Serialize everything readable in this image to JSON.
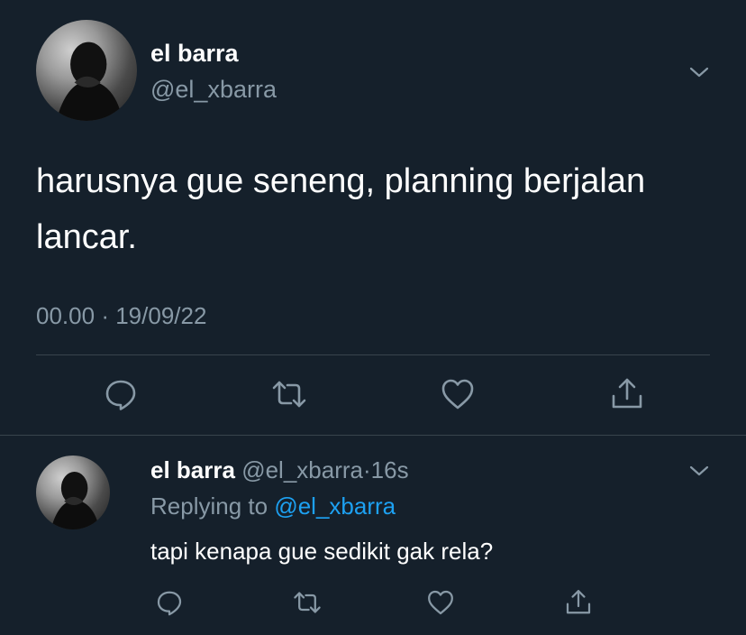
{
  "tweet": {
    "display_name": "el barra",
    "handle": "@el_xbarra",
    "text": "harusnya gue seneng, planning berjalan lancar.",
    "time": "00.00",
    "separator": "·",
    "date": "19/09/22"
  },
  "reply": {
    "display_name": "el barra",
    "handle": "@el_xbarra",
    "separator": "·",
    "age": "16s",
    "replying_label": "Replying to",
    "replying_to": "@el_xbarra",
    "text": "tapi kenapa gue sedikit gak rela?"
  },
  "actions": [
    "reply-icon",
    "retweet-icon",
    "like-icon",
    "share-icon"
  ],
  "colors": {
    "background": "#15202b",
    "muted": "#8899a6",
    "link": "#1da1f2",
    "divider": "#38444d"
  }
}
